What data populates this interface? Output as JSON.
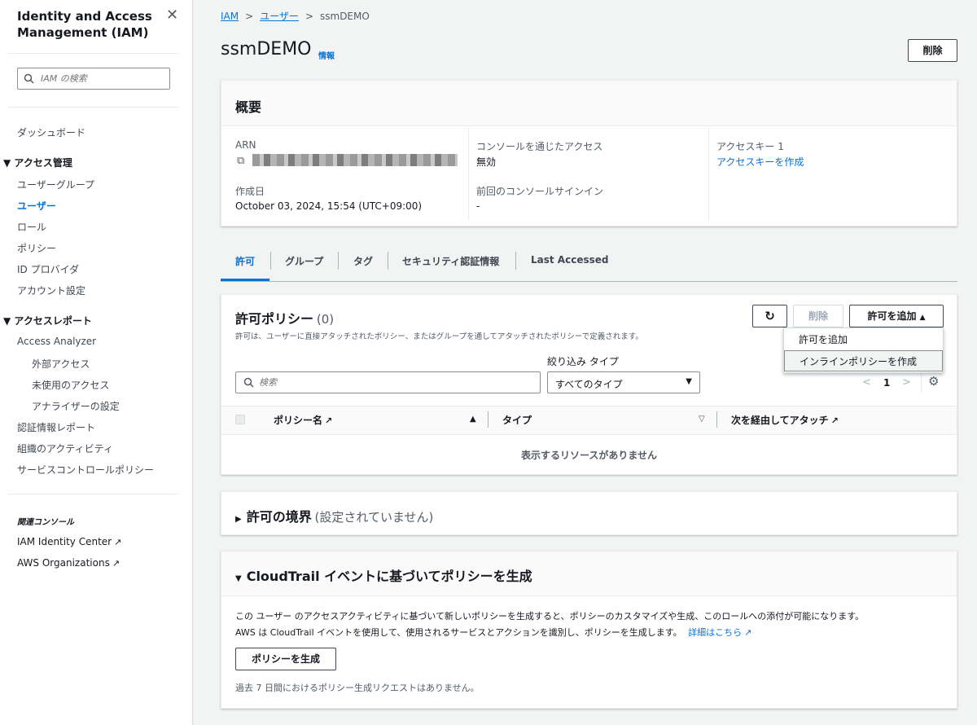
{
  "sidebar": {
    "title": "Identity and Access Management (IAM)",
    "search_placeholder": "IAM の検索",
    "dashboard": "ダッシュボード",
    "access_management": "アクセス管理",
    "user_groups": "ユーザーグループ",
    "users": "ユーザー",
    "roles": "ロール",
    "policies": "ポリシー",
    "id_providers": "ID プロバイダ",
    "account_settings": "アカウント設定",
    "access_reports": "アクセスレポート",
    "access_analyzer": "Access Analyzer",
    "external_access": "外部アクセス",
    "unused_access": "未使用のアクセス",
    "analyzer_settings": "アナライザーの設定",
    "credential_report": "認証情報レポート",
    "org_activity": "組織のアクティビティ",
    "scp": "サービスコントロールポリシー",
    "related_consoles": "関連コンソール",
    "identity_center": "IAM Identity Center",
    "organizations": "AWS Organizations"
  },
  "breadcrumb": {
    "iam": "IAM",
    "users": "ユーザー",
    "current": "ssmDEMO"
  },
  "page": {
    "title": "ssmDEMO",
    "info": "情報",
    "delete": "削除"
  },
  "summary": {
    "heading": "概要",
    "arn_label": "ARN",
    "created_label": "作成日",
    "created_value": "October 03, 2024, 15:54 (UTC+09:00)",
    "console_access_label": "コンソールを通じたアクセス",
    "console_access_value": "無効",
    "last_signin_label": "前回のコンソールサインイン",
    "last_signin_value": "-",
    "access_key_label": "アクセスキー 1",
    "access_key_link": "アクセスキーを作成"
  },
  "tabs": [
    "許可",
    "グループ",
    "タグ",
    "セキュリティ認証情報",
    "Last Accessed"
  ],
  "permissions": {
    "heading": "許可ポリシー",
    "count": "(0)",
    "description": "許可は、ユーザーに直接アタッチされたポリシー、またはグループを通してアタッチされたポリシーで定義されます。",
    "delete": "削除",
    "add": "許可を追加",
    "filter_label": "絞り込み タイプ",
    "search_placeholder": "検索",
    "type_select": "すべてのタイプ",
    "page": "1",
    "col_policy": "ポリシー名",
    "col_type": "タイプ",
    "col_attached": "次を経由してアタッチ",
    "empty": "表示するリソースがありません",
    "menu": [
      "許可を追加",
      "インラインポリシーを作成"
    ]
  },
  "boundary": {
    "heading": "許可の境界",
    "sub": "(設定されていません)"
  },
  "cloudtrail": {
    "heading": "CloudTrail イベントに基づいてポリシーを生成",
    "line1": "この ユーザー のアクセスアクティビティに基づいて新しいポリシーを生成すると、ポリシーのカスタマイズや生成、このロールへの添付が可能になります。",
    "line2": "AWS は CloudTrail イベントを使用して、使用されるサービスとアクションを識別し、ポリシーを生成します。",
    "details": "詳細はこちら",
    "button": "ポリシーを生成",
    "note": "過去 7 日間におけるポリシー生成リクエストはありません。"
  },
  "colors": {
    "accent": "#0972d3",
    "text": "#16191f",
    "muted": "#545b64",
    "bg": "#f2f3f3"
  }
}
